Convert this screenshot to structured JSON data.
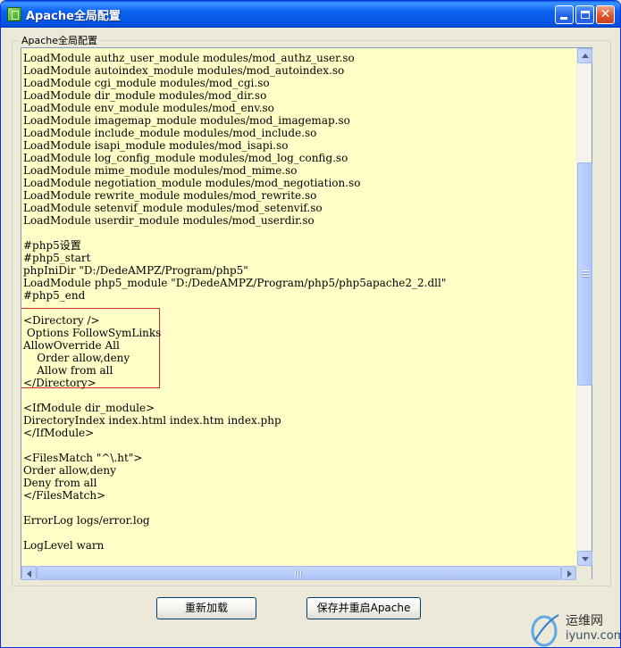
{
  "window": {
    "title": "Apache全局配置",
    "controls": {
      "minimize": "minimize-icon",
      "maximize": "maximize-icon",
      "close": "close-icon"
    }
  },
  "group": {
    "label": "Apache全局配置"
  },
  "editor": {
    "lines": [
      "LoadModule authz_user_module modules/mod_authz_user.so",
      "LoadModule autoindex_module modules/mod_autoindex.so",
      "LoadModule cgi_module modules/mod_cgi.so",
      "LoadModule dir_module modules/mod_dir.so",
      "LoadModule env_module modules/mod_env.so",
      "LoadModule imagemap_module modules/mod_imagemap.so",
      "LoadModule include_module modules/mod_include.so",
      "LoadModule isapi_module modules/mod_isapi.so",
      "LoadModule log_config_module modules/mod_log_config.so",
      "LoadModule mime_module modules/mod_mime.so",
      "LoadModule negotiation_module modules/mod_negotiation.so",
      "LoadModule rewrite_module modules/mod_rewrite.so",
      "LoadModule setenvif_module modules/mod_setenvif.so",
      "LoadModule userdir_module modules/mod_userdir.so",
      "",
      "#php5设置",
      "#php5_start",
      "phpIniDir \"D:/DedeAMPZ/Program/php5\"",
      "LoadModule php5_module \"D:/DedeAMPZ/Program/php5/php5apache2_2.dll\"",
      "#php5_end",
      "",
      "<Directory />",
      " Options FollowSymLinks",
      "AllowOverride All",
      "    Order allow,deny",
      "    Allow from all",
      "</Directory>",
      "",
      "<IfModule dir_module>",
      "DirectoryIndex index.html index.htm index.php",
      "</IfModule>",
      "",
      "<FilesMatch \"^\\.ht\">",
      "Order allow,deny",
      "Deny from all",
      "</FilesMatch>",
      "",
      "ErrorLog logs/error.log",
      "",
      "LogLevel warn"
    ]
  },
  "buttons": {
    "reload": "重新加载",
    "save_restart": "保存并重启Apache"
  },
  "watermark": {
    "name": "运维网",
    "url": "iyunv.com"
  },
  "colors": {
    "editor_bg": "#ffffc7",
    "highlight_border": "#cc2b2b",
    "titlebar": "#0a61f0"
  }
}
